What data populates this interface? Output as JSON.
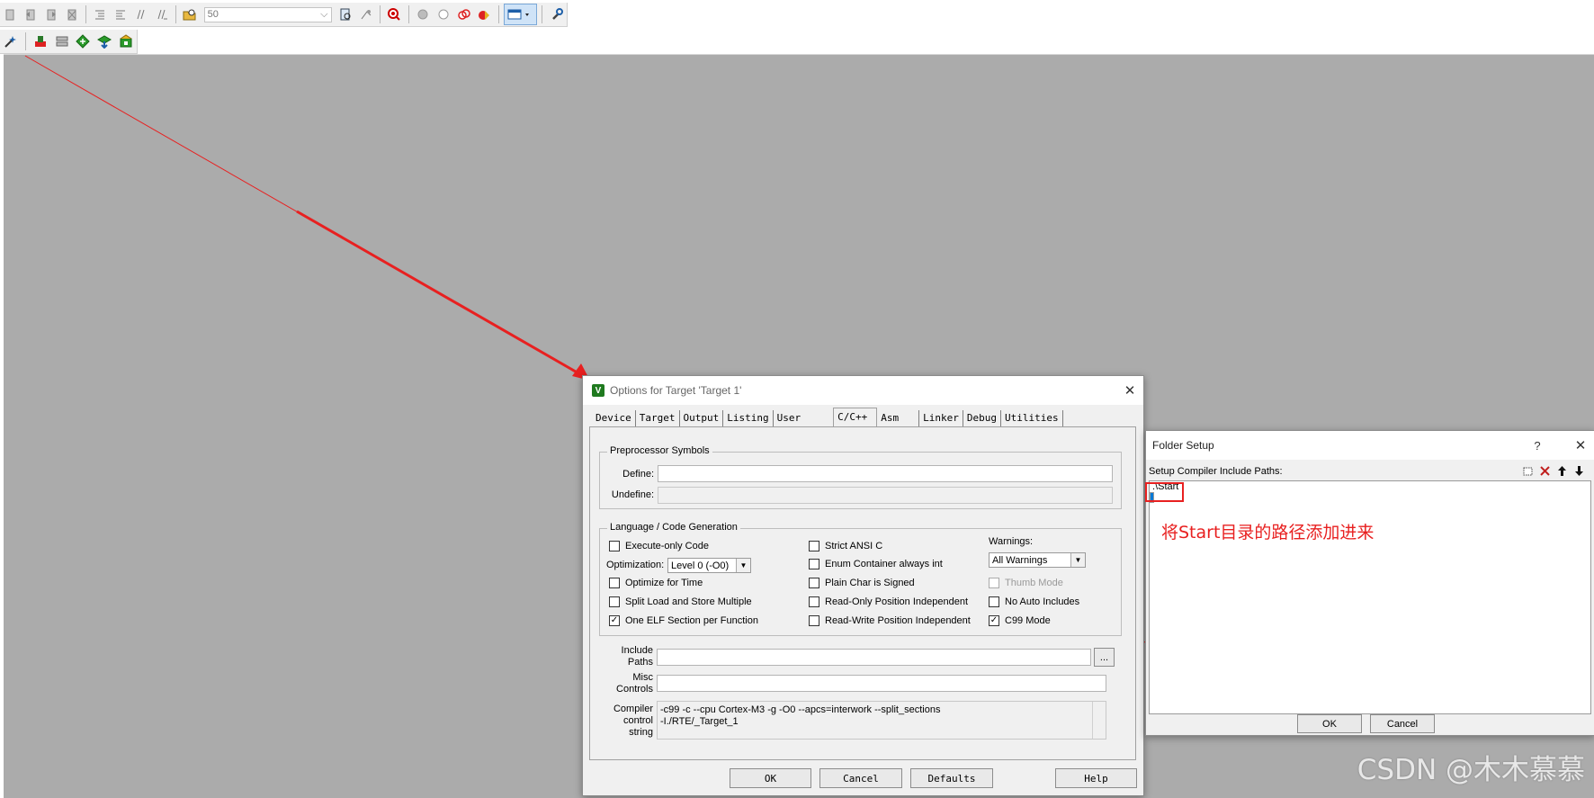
{
  "toolbar": {
    "zoom_value": "50",
    "row1_icons": [
      "bookmark-icon",
      "prev-bookmark-icon",
      "next-bookmark-icon",
      "clear-bookmarks-icon",
      "indent-icon",
      "unindent-icon",
      "comment-icon",
      "uncomment-icon",
      "find-in-files-icon",
      "find-icon",
      "incremental-find-icon",
      "debug-start-icon",
      "breakpoint-icon",
      "disable-breakpoint-icon",
      "kill-breakpoints-icon",
      "kill-all-breakpoints-icon",
      "window-layout-icon",
      "configure-icon"
    ],
    "row2_icons": [
      "wizard-icon",
      "translate-icon",
      "build-icon",
      "rebuild-icon",
      "download-icon",
      "pack-installer-icon"
    ]
  },
  "options_dialog": {
    "title": "Options for Target 'Target 1'",
    "close_label": "✕",
    "tabs": [
      "Device",
      "Target",
      "Output",
      "Listing",
      "User",
      "C/C++",
      "Asm",
      "Linker",
      "Debug",
      "Utilities"
    ],
    "active_tab": "C/C++",
    "preprocessor": {
      "group_label": "Preprocessor Symbols",
      "define_label": "Define:",
      "define_value": "",
      "undefine_label": "Undefine:",
      "undefine_value": ""
    },
    "codegen": {
      "group_label": "Language / Code Generation",
      "execute_only": {
        "label": "Execute-only Code",
        "checked": ""
      },
      "optimization_label": "Optimization:",
      "optimization_value": "Level 0 (-O0)",
      "optimize_time": {
        "label": "Optimize for Time",
        "checked": ""
      },
      "split_load": {
        "label": "Split Load and Store Multiple",
        "checked": ""
      },
      "one_elf": {
        "label": "One ELF Section per Function",
        "checked": "✓"
      },
      "strict_ansi": {
        "label": "Strict ANSI C",
        "checked": ""
      },
      "enum_container": {
        "label": "Enum Container always int",
        "checked": ""
      },
      "plain_char": {
        "label": "Plain Char is Signed",
        "checked": ""
      },
      "ro_pi": {
        "label": "Read-Only Position Independent",
        "checked": ""
      },
      "rw_pi": {
        "label": "Read-Write Position Independent",
        "checked": ""
      },
      "warnings_label": "Warnings:",
      "warnings_value": "All Warnings",
      "thumb_mode": {
        "label": "Thumb Mode",
        "checked": ""
      },
      "no_auto_includes": {
        "label": "No Auto Includes",
        "checked": ""
      },
      "c99_mode": {
        "label": "C99 Mode",
        "checked": "✓"
      }
    },
    "include_paths": {
      "label_line1": "Include",
      "label_line2": "Paths",
      "value": "",
      "browse_label": "..."
    },
    "misc_controls": {
      "label_line1": "Misc",
      "label_line2": "Controls",
      "value": ""
    },
    "compiler_control": {
      "label_line1": "Compiler",
      "label_line2": "control",
      "label_line3": "string",
      "value": "-c99 -c --cpu Cortex-M3 -g -O0 --apcs=interwork --split_sections\n-I./RTE/_Target_1"
    },
    "buttons": {
      "ok": "OK",
      "cancel": "Cancel",
      "defaults": "Defaults",
      "help": "Help"
    }
  },
  "folder_setup": {
    "title": "Folder Setup",
    "help_label": "?",
    "close_label": "✕",
    "header_label": "Setup Compiler Include Paths:",
    "tools": [
      "new-folder-icon",
      "delete-icon",
      "move-up-icon",
      "move-down-icon"
    ],
    "paths": [
      ".\\Start",
      ""
    ],
    "buttons": {
      "ok": "OK",
      "cancel": "Cancel"
    }
  },
  "annotation": {
    "text": "将Start目录的路径添加进来",
    "color": "#e82020"
  },
  "watermark": "CSDN @木木慕慕"
}
